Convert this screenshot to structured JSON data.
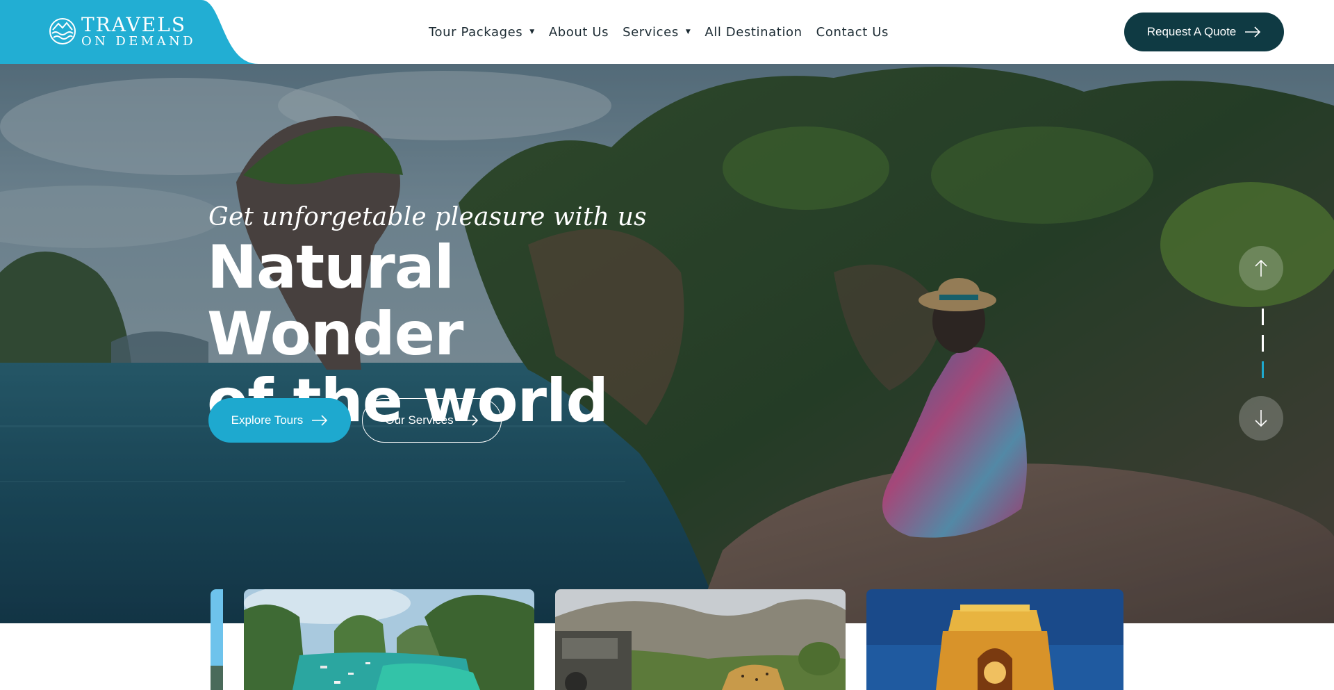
{
  "brand": {
    "line1": "TRAVELS",
    "line2": "ON DEMAND",
    "tab_color": "#22aed3"
  },
  "nav": {
    "items": [
      {
        "label": "Tour Packages",
        "has_dropdown": true
      },
      {
        "label": "About Us",
        "has_dropdown": false
      },
      {
        "label": "Services",
        "has_dropdown": true
      },
      {
        "label": "All Destination",
        "has_dropdown": false
      },
      {
        "label": "Contact Us",
        "has_dropdown": false
      }
    ],
    "caret_glyph": "▼"
  },
  "header": {
    "quote_label": "Request A Quote",
    "quote_icon": "arrow-right-icon"
  },
  "hero": {
    "tagline": "Get unforgetable pleasure with us",
    "headline_line1": "Natural Wonder",
    "headline_line2": "of the world",
    "primary_cta": "Explore Tours",
    "secondary_cta": "Our Services",
    "slider": {
      "total_slides": 3,
      "active_slide": 3
    }
  },
  "cards": [
    {
      "subject": "partial card"
    },
    {
      "subject": "bay with limestone islands and boats"
    },
    {
      "subject": "safari jeep with leopard"
    },
    {
      "subject": "india gate at night"
    }
  ],
  "colors": {
    "accent": "#1ea9cf",
    "dark": "#0f3a43",
    "nav_text": "#1c2b33",
    "active_indicator": "#1ea9cf"
  }
}
